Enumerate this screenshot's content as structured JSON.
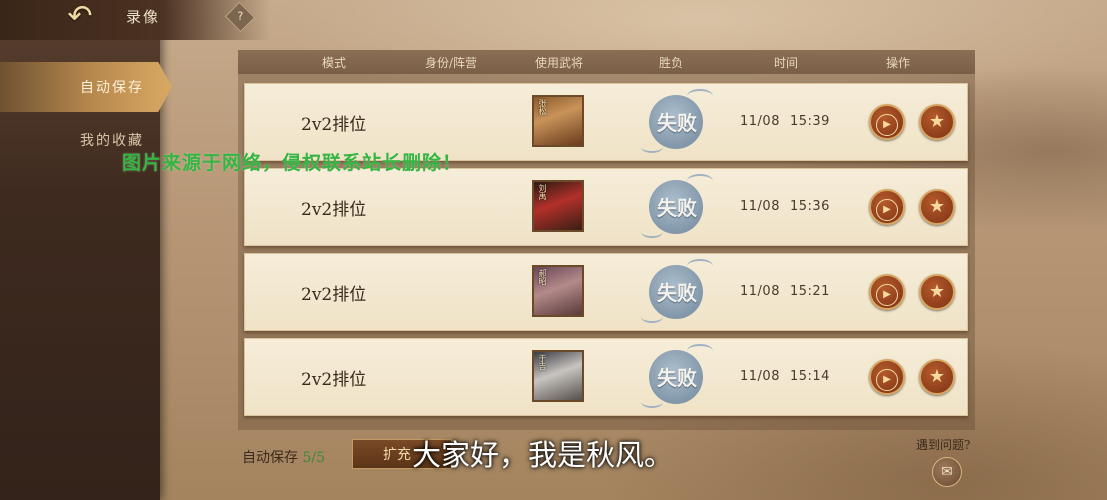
{
  "header": {
    "title": "录像",
    "back_icon": "↶",
    "help_label": "?"
  },
  "sidebar": {
    "tabs": [
      {
        "label": "自动保存",
        "active": true
      },
      {
        "label": "我的收藏",
        "active": false
      }
    ]
  },
  "table": {
    "columns": [
      "模式",
      "身份/阵营",
      "使用武将",
      "胜负",
      "时间",
      "操作"
    ],
    "rows": [
      {
        "mode": "2v2排位",
        "general_tag": "张松",
        "result": "失败",
        "date": "11/08",
        "time": "15:39"
      },
      {
        "mode": "2v2排位",
        "general_tag": "刘禹",
        "result": "失败",
        "date": "11/08",
        "time": "15:36"
      },
      {
        "mode": "2v2排位",
        "general_tag": "郝昭",
        "result": "失败",
        "date": "11/08",
        "time": "15:21"
      },
      {
        "mode": "2v2排位",
        "general_tag": "于吉",
        "result": "失败",
        "date": "11/08",
        "time": "15:14"
      }
    ]
  },
  "footer": {
    "autosave_label": "自动保存",
    "autosave_count": "5/5",
    "expand_label": "扩充",
    "help_link": "遇到问题?",
    "help_icon": "✉"
  },
  "overlay": {
    "watermark": "图片来源于网络，侵权联系站长删除！",
    "subtitle": "大家好，我是秋风。"
  },
  "colors": {
    "accent": "#d8a863",
    "panel_dark": "#3e2a1f",
    "row_bg": "#f2e6cd",
    "result_blue": "#8fa5b9",
    "button_red": "#8e3e1b",
    "count_green": "#3a8a3a",
    "watermark_green": "#35b541"
  },
  "icons": {
    "back": "back-arrow-icon",
    "help": "question-icon",
    "play": "play-icon",
    "favorite": "star-icon",
    "feedback": "feedback-icon"
  }
}
